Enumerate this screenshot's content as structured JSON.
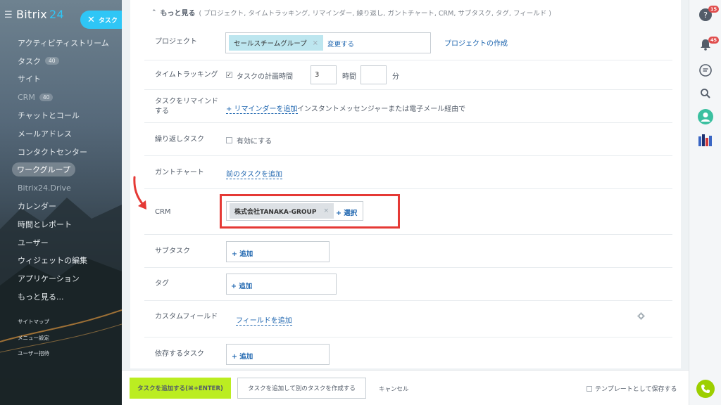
{
  "sidebar": {
    "logo_text": "Bitrix",
    "logo_num": "24",
    "task_chip_label": "タスク",
    "items": [
      {
        "label": "アクティビティストリーム"
      },
      {
        "label": "タスク",
        "count": "40"
      },
      {
        "label": "サイト"
      },
      {
        "label": "CRM",
        "count": "40"
      },
      {
        "label": "チャットとコール"
      },
      {
        "label": "メールアドレス"
      },
      {
        "label": "コンタクトセンター"
      },
      {
        "label": "ワークグループ"
      },
      {
        "label": "Bitrix24.Drive"
      },
      {
        "label": "カレンダー"
      },
      {
        "label": "時間とレポート"
      },
      {
        "label": "ユーザー"
      },
      {
        "label": "ウィジェットの編集"
      },
      {
        "label": "アプリケーション"
      },
      {
        "label": "もっと見る..."
      }
    ],
    "small_items": [
      "サイトマップ",
      "メニュー設定",
      "ユーザー招待"
    ]
  },
  "more": {
    "title": "もっと見る",
    "subtitle": "( プロジェクト, タイムトラッキング, リマインダー, 繰り返し, ガントチャート, CRM, サブタスク, タグ, フィールド )"
  },
  "form": {
    "project": {
      "label": "プロジェクト",
      "chip": "セールスチームグループ",
      "change": "変更する",
      "create": "プロジェクトの作成"
    },
    "time": {
      "label": "タイムトラッキング",
      "checkbox_label": "タスクの計画時間",
      "hours_value": "3",
      "hours_unit": "時間",
      "minutes_value": "",
      "minutes_unit": "分"
    },
    "remind": {
      "label": "タスクをリマインド する",
      "add": "+ リマインダーを追加",
      "desc": "インスタントメッセンジャーまたは電子メール経由で"
    },
    "repeat": {
      "label": "繰り返しタスク",
      "checkbox_label": "有効にする"
    },
    "gantt": {
      "label": "ガントチャート",
      "add": "前のタスクを追加"
    },
    "crm": {
      "label": "CRM",
      "chip": "株式会社TANAKA-GROUP",
      "select": "+ 選択"
    },
    "subtask": {
      "label": "サブタスク",
      "add": "+ 追加"
    },
    "tag": {
      "label": "タグ",
      "add": "+ 追加"
    },
    "custom": {
      "label": "カスタムフィールド",
      "add": "フィールドを追加"
    },
    "depend": {
      "label": "依存するタスク",
      "add": "+ 追加"
    }
  },
  "footer": {
    "add_task": "タスクを追加する(⌘+ENTER)",
    "add_and_create": "タスクを追加して別のタスクを作成する",
    "cancel": "キャンセル",
    "save_template": "テンプレートとして保存する"
  },
  "rightbar": {
    "help_badge": "15",
    "notify_badge": "45"
  },
  "colors": {
    "accent_blue": "#2fc6f6",
    "link": "#2067b0",
    "primary_button": "#bbed21",
    "highlight_red": "#e53935",
    "badge_red": "#e04e4e"
  }
}
